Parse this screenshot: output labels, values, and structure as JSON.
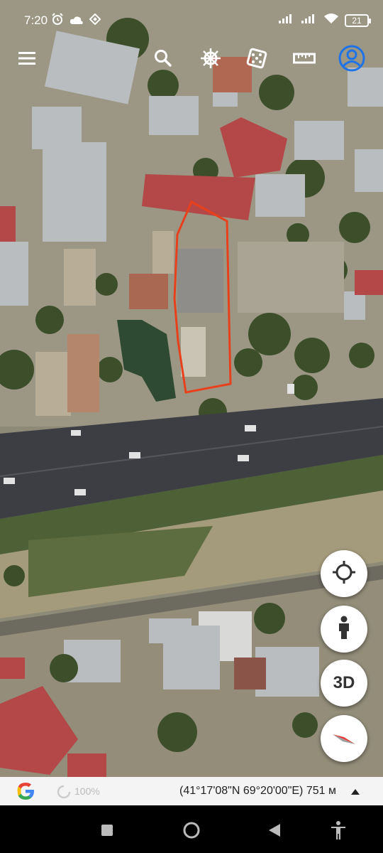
{
  "status_bar": {
    "time": "7:20",
    "battery": "21",
    "left_icons": [
      "alarm-icon",
      "cloud-icon",
      "diamond-notification-icon"
    ],
    "right_icons": [
      "signal-icon",
      "signal-icon",
      "wifi-icon",
      "battery-icon"
    ]
  },
  "toolbar": {
    "buttons": [
      "menu-icon",
      "search-icon",
      "ship-wheel-icon",
      "dice-icon",
      "ruler-icon",
      "account-icon"
    ],
    "account_color": "#1e73e8"
  },
  "map": {
    "outline_color": "#e8401c",
    "road_color": "#3d3e44"
  },
  "fabs": {
    "my_location": "crosshair-icon",
    "street_view": "person-icon",
    "three_d_label": "3D",
    "compass": "compass-icon"
  },
  "info_bar": {
    "zoom": "100%",
    "coordinates": "(41°17'08\"N 69°20'00\"E) 751 м"
  },
  "nav_bar": {
    "buttons": [
      "recents-square-icon",
      "home-circle-icon",
      "back-triangle-icon",
      "accessibility-icon"
    ]
  }
}
